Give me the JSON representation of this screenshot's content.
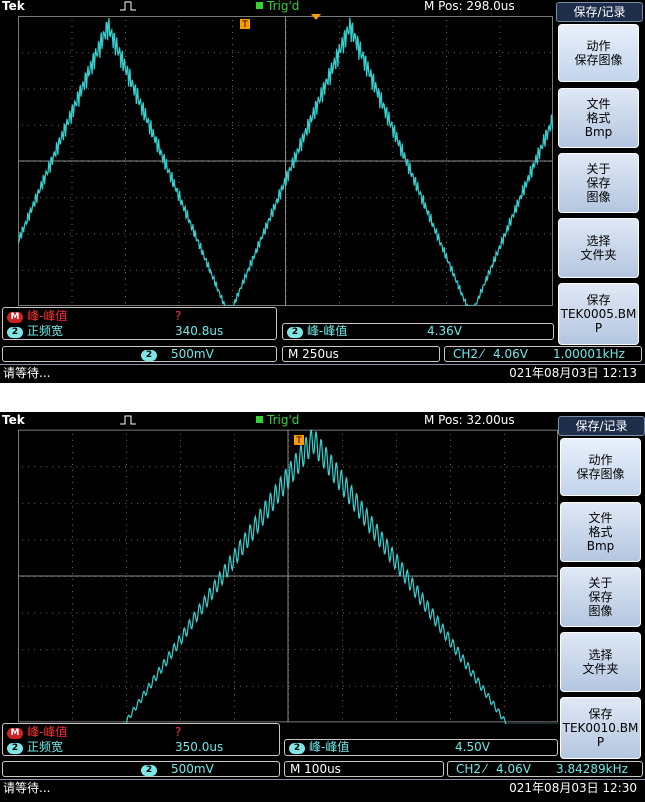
{
  "screens": [
    {
      "id": "scope-1",
      "brand": "Tek",
      "trigger_status": "Trig'd",
      "m_pos": "M Pos: 298.0us",
      "menu": {
        "title": "保存/记录",
        "buttons": [
          {
            "label": "动作\n保存图像"
          },
          {
            "label": "文件\n格式\nBmp"
          },
          {
            "label": "关于\n保存\n图像"
          },
          {
            "label": "选择\n文件夹"
          },
          {
            "label": "保存\nTEK0005.BM\nP"
          }
        ]
      },
      "measurements": {
        "row1_badge": "M",
        "row1_label": "峰-峰值",
        "row1_value": "?",
        "row2_badge": "2",
        "row2_label": "正频宽",
        "row2_value": "340.8us"
      },
      "measurement2": {
        "badge": "2",
        "label": "峰-峰值",
        "value": "4.36V"
      },
      "channel_scale": {
        "badge": "2",
        "value": "500mV"
      },
      "timebase": "M 250us",
      "trigger_info": {
        "source": "CH2",
        "slope": "⁄",
        "level": "4.06V",
        "freq": "1.00001kHz"
      },
      "status_left": "请等待...",
      "datetime": "021年08月03日 12:13",
      "waveform": {
        "shape": "triangle",
        "cycles_visible": 2.55,
        "noise": "high-frequency ripple"
      }
    },
    {
      "id": "scope-2",
      "brand": "Tek",
      "trigger_status": "Trig'd",
      "m_pos": "M Pos: 32.00us",
      "menu": {
        "title": "保存/记录",
        "buttons": [
          {
            "label": "动作\n保存图像"
          },
          {
            "label": "文件\n格式\nBmp"
          },
          {
            "label": "关于\n保存\n图像"
          },
          {
            "label": "选择\n文件夹"
          },
          {
            "label": "保存\nTEK0010.BM\nP"
          }
        ]
      },
      "measurements": {
        "row1_badge": "M",
        "row1_label": "峰-峰值",
        "row1_value": "?",
        "row2_badge": "2",
        "row2_label": "正频宽",
        "row2_value": "350.0us"
      },
      "measurement2": {
        "badge": "2",
        "label": "峰-峰值",
        "value": "4.50V"
      },
      "channel_scale": {
        "badge": "2",
        "value": "500mV"
      },
      "timebase": "M 100us",
      "trigger_info": {
        "source": "CH2",
        "slope": "⁄",
        "level": "4.06V",
        "freq": "3.84289kHz"
      },
      "status_left": "请等待...",
      "datetime": "021年08月03日 12:30",
      "waveform": {
        "shape": "triangle",
        "cycles_visible": 1,
        "noise": "sinusoidal ripple"
      }
    }
  ],
  "colors": {
    "trace": "#35d0d0",
    "grid": "#7a7a7a",
    "trigger": "#ff9a00",
    "trig_text": "#35d435"
  }
}
